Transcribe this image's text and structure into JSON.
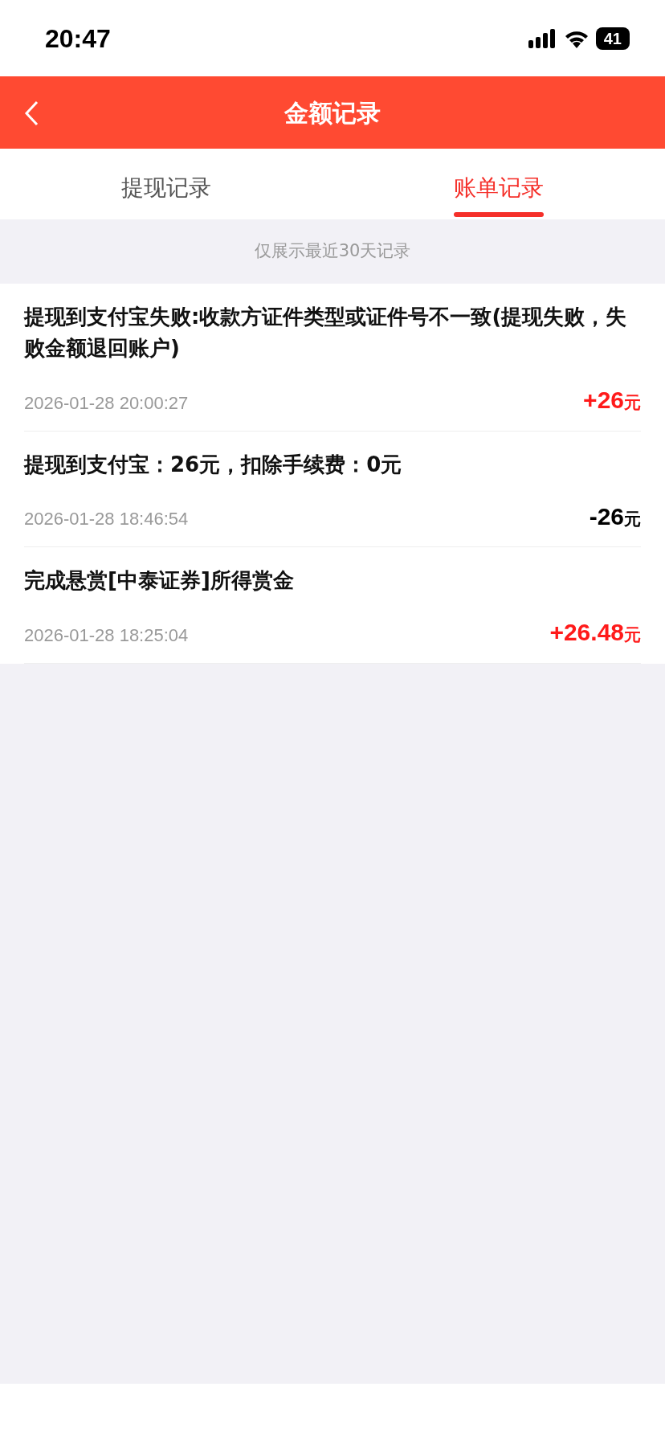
{
  "status_bar": {
    "time": "20:47",
    "battery": "41"
  },
  "header": {
    "title": "金额记录"
  },
  "tabs": [
    {
      "label": "提现记录",
      "selected": false
    },
    {
      "label": "账单记录",
      "selected": true
    }
  ],
  "notice": "仅展示最近30天记录",
  "records": [
    {
      "title": "提现到支付宝失败:收款方证件类型或证件号不一致(提现失败，失败金额退回账户)",
      "time": "2026-01-28 20:00:27",
      "amount": "+26",
      "unit": "元",
      "kind": "income"
    },
    {
      "title": "提现到支付宝：26元，扣除手续费：0元",
      "time": "2026-01-28 18:46:54",
      "amount": "-26",
      "unit": "元",
      "kind": "expense"
    },
    {
      "title": "完成悬赏[中泰证券]所得赏金",
      "time": "2026-01-28 18:25:04",
      "amount": "+26.48",
      "unit": "元",
      "kind": "income"
    }
  ]
}
